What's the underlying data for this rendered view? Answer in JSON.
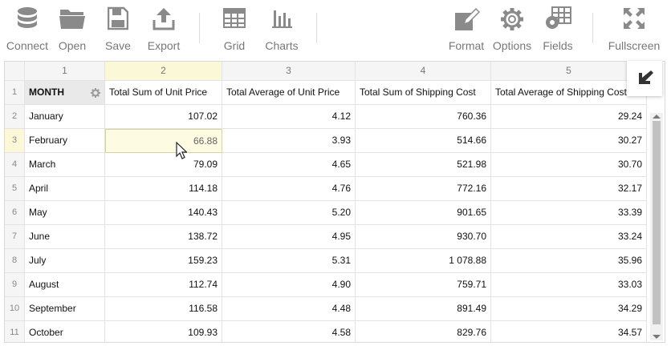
{
  "toolbar": {
    "connect": "Connect",
    "open": "Open",
    "save": "Save",
    "export": "Export",
    "grid": "Grid",
    "charts": "Charts",
    "format": "Format",
    "options": "Options",
    "fields": "Fields",
    "fullscreen": "Fullscreen"
  },
  "columns": [
    "1",
    "2",
    "3",
    "4",
    "5"
  ],
  "header": {
    "rownum": "1",
    "month": "MONTH",
    "c2": "Total Sum of Unit Price",
    "c3": "Total Average of Unit Price",
    "c4": "Total Sum of Shipping Cost",
    "c5": "Total Average of Shipping Cost"
  },
  "rows": [
    {
      "n": "2",
      "month": "January",
      "c2": "107.02",
      "c3": "4.12",
      "c4": "760.36",
      "c5": "29.24"
    },
    {
      "n": "3",
      "month": "February",
      "c2": "66.88",
      "c3": "3.93",
      "c4": "514.66",
      "c5": "30.27"
    },
    {
      "n": "4",
      "month": "March",
      "c2": "79.09",
      "c3": "4.65",
      "c4": "521.98",
      "c5": "30.70"
    },
    {
      "n": "5",
      "month": "April",
      "c2": "114.18",
      "c3": "4.76",
      "c4": "772.16",
      "c5": "32.17"
    },
    {
      "n": "6",
      "month": "May",
      "c2": "140.43",
      "c3": "5.20",
      "c4": "901.65",
      "c5": "33.39"
    },
    {
      "n": "7",
      "month": "June",
      "c2": "138.72",
      "c3": "4.95",
      "c4": "930.70",
      "c5": "33.24"
    },
    {
      "n": "8",
      "month": "July",
      "c2": "159.23",
      "c3": "5.31",
      "c4": "1 078.88",
      "c5": "35.96"
    },
    {
      "n": "9",
      "month": "August",
      "c2": "112.74",
      "c3": "4.90",
      "c4": "759.71",
      "c5": "33.03"
    },
    {
      "n": "10",
      "month": "September",
      "c2": "116.58",
      "c3": "4.48",
      "c4": "891.49",
      "c5": "34.29"
    },
    {
      "n": "11",
      "month": "October",
      "c2": "109.93",
      "c3": "4.58",
      "c4": "829.76",
      "c5": "34.57"
    }
  ],
  "selected_row": "3",
  "selected_column": "2",
  "colors": {
    "selection": "#fdfbe2",
    "toolbar_icon": "#8a8a8a"
  }
}
